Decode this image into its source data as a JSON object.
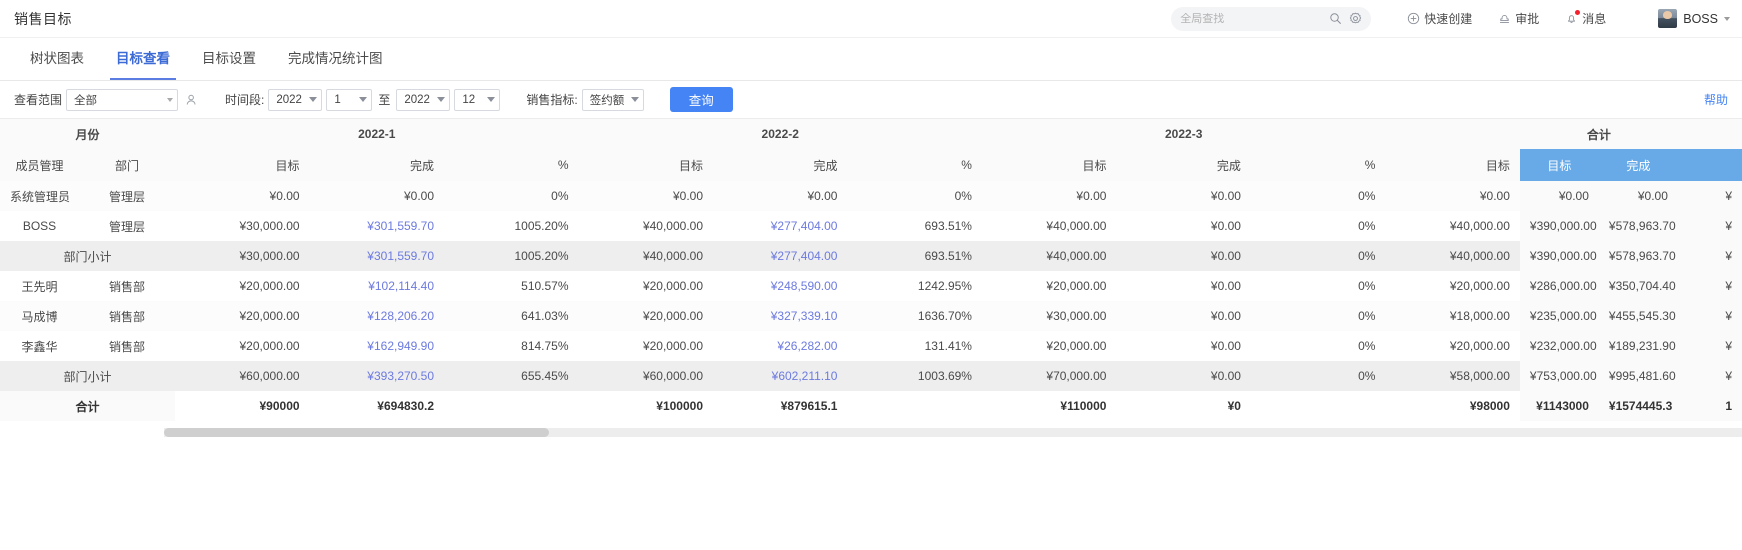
{
  "header": {
    "app_title": "销售目标",
    "search": {
      "placeholder": "全局查找",
      "value": ""
    },
    "search_icon": "search-icon",
    "settings_icon": "gear-icon",
    "actions": [
      {
        "label": "快速创建",
        "icon": "plus-circle-icon",
        "badge": false
      },
      {
        "label": "审批",
        "icon": "stamp-icon",
        "badge": false
      },
      {
        "label": "消息",
        "icon": "bell-icon",
        "badge": true
      }
    ],
    "user": {
      "name": "BOSS",
      "avatar": "avatar"
    }
  },
  "tabs": [
    {
      "label": "树状图表",
      "active": false
    },
    {
      "label": "目标查看",
      "active": true
    },
    {
      "label": "目标设置",
      "active": false
    },
    {
      "label": "完成情况统计图",
      "active": false
    }
  ],
  "filters": {
    "scope_label": "查看范围",
    "scope_value": "全部",
    "person_icon": "person-picker-icon",
    "period_label": "时间段:",
    "start_year": "2022",
    "start_month": "1",
    "to_label": "至",
    "end_year": "2022",
    "end_month": "12",
    "metric_label": "销售指标:",
    "metric_value": "签约额",
    "query_button": "查询",
    "help_link": "帮助"
  },
  "table": {
    "month_label": "月份",
    "member_label": "成员管理",
    "dept_label": "部门",
    "total_label": "合计",
    "months": [
      "2022-1",
      "2022-2",
      "2022-3"
    ],
    "sub_headers": [
      "目标",
      "完成",
      "%"
    ],
    "total_sub_headers": [
      "目标",
      "完成"
    ],
    "rows": [
      {
        "name": "系统管理员",
        "dept": "管理层",
        "type": "normal",
        "cells": [
          "¥0.00",
          "¥0.00",
          "0%",
          "¥0.00",
          "¥0.00",
          "0%",
          "¥0.00",
          "¥0.00",
          "0%",
          "¥0.00"
        ],
        "total": [
          "¥0.00",
          "¥0.00"
        ]
      },
      {
        "name": "BOSS",
        "dept": "管理层",
        "type": "normal",
        "cells": [
          "¥30,000.00",
          "¥301,559.70",
          "1005.20%",
          "¥40,000.00",
          "¥277,404.00",
          "693.51%",
          "¥40,000.00",
          "¥0.00",
          "0%",
          "¥40,000.00"
        ],
        "total": [
          "¥390,000.00",
          "¥578,963.70"
        ]
      },
      {
        "name": "部门小计",
        "dept": "",
        "type": "subtotal",
        "cells": [
          "¥30,000.00",
          "¥301,559.70",
          "1005.20%",
          "¥40,000.00",
          "¥277,404.00",
          "693.51%",
          "¥40,000.00",
          "¥0.00",
          "0%",
          "¥40,000.00"
        ],
        "total": [
          "¥390,000.00",
          "¥578,963.70"
        ]
      },
      {
        "name": "王先明",
        "dept": "销售部",
        "type": "normal",
        "cells": [
          "¥20,000.00",
          "¥102,114.40",
          "510.57%",
          "¥20,000.00",
          "¥248,590.00",
          "1242.95%",
          "¥20,000.00",
          "¥0.00",
          "0%",
          "¥20,000.00"
        ],
        "total": [
          "¥286,000.00",
          "¥350,704.40"
        ]
      },
      {
        "name": "马成博",
        "dept": "销售部",
        "type": "normal",
        "cells": [
          "¥20,000.00",
          "¥128,206.20",
          "641.03%",
          "¥20,000.00",
          "¥327,339.10",
          "1636.70%",
          "¥30,000.00",
          "¥0.00",
          "0%",
          "¥18,000.00"
        ],
        "total": [
          "¥235,000.00",
          "¥455,545.30"
        ]
      },
      {
        "name": "李鑫华",
        "dept": "销售部",
        "type": "normal",
        "cells": [
          "¥20,000.00",
          "¥162,949.90",
          "814.75%",
          "¥20,000.00",
          "¥26,282.00",
          "131.41%",
          "¥20,000.00",
          "¥0.00",
          "0%",
          "¥20,000.00"
        ],
        "total": [
          "¥232,000.00",
          "¥189,231.90"
        ]
      },
      {
        "name": "部门小计",
        "dept": "",
        "type": "subtotal",
        "cells": [
          "¥60,000.00",
          "¥393,270.50",
          "655.45%",
          "¥60,000.00",
          "¥602,211.10",
          "1003.69%",
          "¥70,000.00",
          "¥0.00",
          "0%",
          "¥58,000.00"
        ],
        "total": [
          "¥753,000.00",
          "¥995,481.60"
        ]
      },
      {
        "name": "合计",
        "dept": "",
        "type": "grand",
        "cells": [
          "¥90000",
          "¥694830.2",
          "",
          "¥100000",
          "¥879615.1",
          "",
          "¥110000",
          "¥0",
          "",
          "¥98000"
        ],
        "total": [
          "¥1143000",
          "¥1574445.3"
        ]
      }
    ]
  },
  "colors": {
    "accent": "#4584f5",
    "tab_active": "#3d6bd6",
    "link": "#6c7ae0",
    "frozen_header": "#68aae8"
  }
}
